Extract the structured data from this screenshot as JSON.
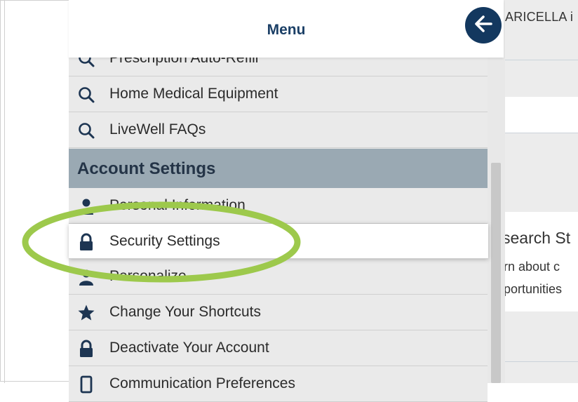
{
  "background": {
    "name_text": "ARICELLA i",
    "research_title": "search St",
    "research_line1": "rn about c",
    "research_line2": "portunities"
  },
  "menu": {
    "title": "Menu",
    "back_icon": "arrow-left-icon",
    "items_top": [
      {
        "label": "Prescription Auto-Refill",
        "icon": "search-icon"
      },
      {
        "label": "Home Medical Equipment",
        "icon": "search-icon"
      },
      {
        "label": "LiveWell FAQs",
        "icon": "search-icon"
      }
    ],
    "section_title": "Account Settings",
    "account_items": [
      {
        "label": "Personal Information",
        "icon": "person-icon"
      },
      {
        "label": "Security Settings",
        "icon": "lock-icon"
      },
      {
        "label": "Personalize",
        "icon": "person-icon"
      },
      {
        "label": "Change Your Shortcuts",
        "icon": "star-icon"
      },
      {
        "label": "Deactivate Your Account",
        "icon": "lock-icon"
      },
      {
        "label": "Communication Preferences",
        "icon": "phone-icon"
      }
    ]
  },
  "colors": {
    "highlight_ellipse": "#9dc94c",
    "header_text": "#1b3f66",
    "section_bg": "#9aa9b3",
    "icon_color": "#1d3552"
  }
}
